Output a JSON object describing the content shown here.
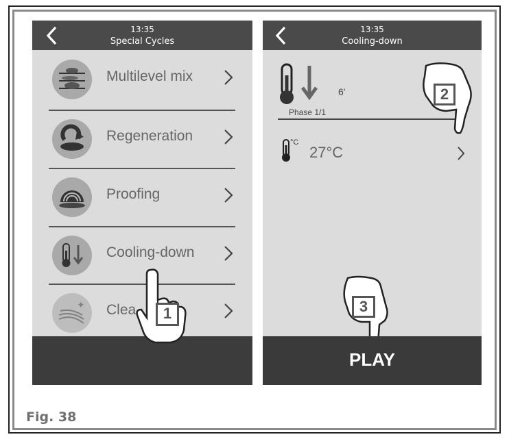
{
  "figure": {
    "label": "Fig. 38"
  },
  "left_screen": {
    "time": "13:35",
    "title": "Special Cycles",
    "items": [
      {
        "label": "Multilevel mix",
        "icon": "multilevel-icon"
      },
      {
        "label": "Regeneration",
        "icon": "regeneration-icon"
      },
      {
        "label": "Proofing",
        "icon": "proofing-icon"
      },
      {
        "label": "Cooling-down",
        "icon": "cooling-icon"
      },
      {
        "label": "Clea",
        "icon": "cleaning-icon"
      }
    ]
  },
  "right_screen": {
    "time": "13:35",
    "title": "Cooling-down",
    "phase_duration": "6'",
    "phase_label": "Phase 1/1",
    "temperature": "27°C",
    "unit_symbol": "°C",
    "play_label": "PLAY"
  },
  "callouts": [
    "1",
    "2",
    "3"
  ],
  "colors": {
    "topbar": "#4a4a4a",
    "screen_bg": "#dcdcdc",
    "bottom_bar": "#3c3c3c",
    "icon_circle": "#a9a9a9"
  }
}
